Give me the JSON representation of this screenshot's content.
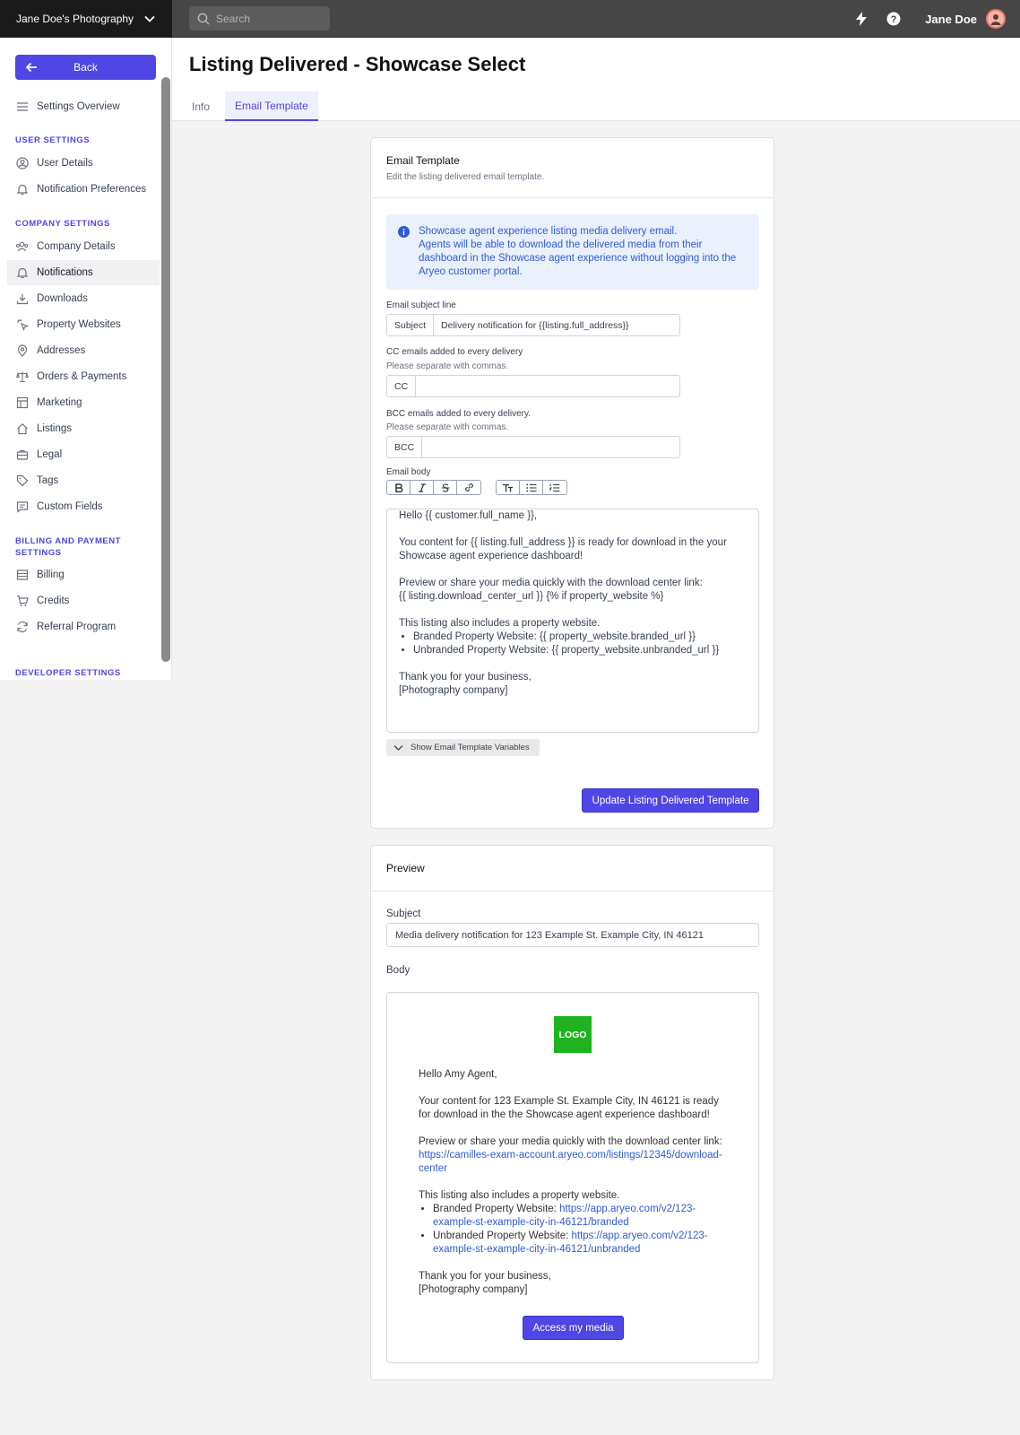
{
  "app": {
    "brand": "Jane Doe's Photography",
    "search_placeholder": "Search",
    "user_name": "Jane Doe"
  },
  "sidebar": {
    "back_label": "Back",
    "overview": "Settings Overview",
    "sections": {
      "user": "USER SETTINGS",
      "company": "COMPANY SETTINGS",
      "billing": "BILLING AND PAYMENT SETTINGS",
      "developer": "DEVELOPER SETTINGS"
    },
    "user_items": [
      "User Details",
      "Notification Preferences"
    ],
    "company_items": [
      "Company Details",
      "Notifications",
      "Downloads",
      "Property Websites",
      "Addresses",
      "Orders & Payments",
      "Marketing",
      "Listings",
      "Legal",
      "Tags",
      "Custom Fields"
    ],
    "billing_items": [
      "Billing",
      "Credits",
      "Referral Program"
    ],
    "active_item": "Notifications"
  },
  "page": {
    "title": "Listing Delivered - Showcase Select",
    "tabs": [
      "Info",
      "Email Template"
    ],
    "active_tab": "Email Template"
  },
  "template_card": {
    "title": "Email Template",
    "subtitle": "Edit the listing delivered email template.",
    "info_title": "Showcase agent experience listing media delivery email.",
    "info_body": "Agents will be able to download the delivered media from their dashboard in the Showcase agent experience without logging into the Aryeo customer portal.",
    "subject_label": "Email subject line",
    "subject_addon": "Subject",
    "subject_value": "Delivery notification for {{listing.full_address}}",
    "cc_label": "CC emails added to every delivery",
    "cc_hint": "Please separate with commas.",
    "cc_addon": "CC",
    "cc_value": "",
    "bcc_label": "BCC emails added to every delivery.",
    "bcc_hint": "Please separate with commas.",
    "bcc_addon": "BCC",
    "bcc_value": "",
    "body_label": "Email body",
    "body": {
      "greeting": "Hello  {{ customer.full_name }},",
      "para1": "You content for {{ listing.full_address }} is ready for download in the your Showcase agent experience dashboard!",
      "para2_line1": "Preview or share your media quickly with the download center link:",
      "para2_line2": " {{ listing.download_center_url }} {% if property_website %}",
      "para3": "This listing also includes a property website.",
      "bullets": [
        "Branded Property Website: {{ property_website.branded_url }}",
        "Unbranded Property Website: {{ property_website.unbranded_url }}"
      ],
      "closing1": "Thank you for your business,",
      "closing2": "[Photography company]"
    },
    "vars_button": "Show Email Template Variables",
    "update_button": "Update Listing Delivered Template"
  },
  "preview_card": {
    "title": "Preview",
    "subject_label": "Subject",
    "subject_value": "Media delivery notification for 123 Example St. Example City, IN 46121",
    "body_label": "Body",
    "logo": "LOGO",
    "greeting": "Hello Amy Agent,",
    "para1": "Your content for 123 Example St. Example City, IN 46121 is ready for download in the the Showcase agent experience dashboard!",
    "para2": "Preview or share your media quickly with the download center link:",
    "download_link": "https://camilles-exam-account.aryeo.com/listings/12345/download-center",
    "para3": "This listing also includes a property website.",
    "branded_label": "Branded Property Website: ",
    "branded_link": "https://app.aryeo.com/v2/123-example-st-example-city-in-46121/branded",
    "unbranded_label": "Unbranded Property Website: ",
    "unbranded_link": "https://app.aryeo.com/v2/123-example-st-example-city-in-46121/unbranded",
    "closing1": "Thank you for your business,",
    "closing2": "[Photography company]",
    "access_button": "Access my media"
  },
  "colors": {
    "accent": "#4f46e5",
    "info_bg": "#eaf0fc",
    "info_text": "#2f5bd8",
    "logo_green": "#1fb41f"
  }
}
